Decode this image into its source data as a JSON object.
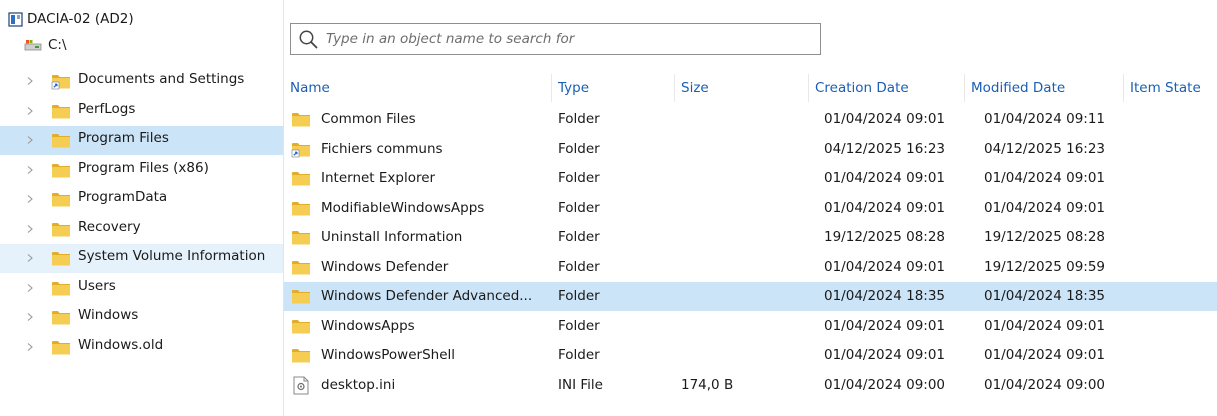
{
  "tree": {
    "root_label": "DACIA-02 (AD2)",
    "drive_label": "C:\\",
    "items": [
      {
        "label": "Documents and Settings",
        "shortcut": true,
        "state": ""
      },
      {
        "label": "PerfLogs",
        "shortcut": false,
        "state": ""
      },
      {
        "label": "Program Files",
        "shortcut": false,
        "state": "selected"
      },
      {
        "label": "Program Files (x86)",
        "shortcut": false,
        "state": ""
      },
      {
        "label": "ProgramData",
        "shortcut": false,
        "state": ""
      },
      {
        "label": "Recovery",
        "shortcut": false,
        "state": ""
      },
      {
        "label": "System Volume Information",
        "shortcut": false,
        "state": "hover"
      },
      {
        "label": "Users",
        "shortcut": false,
        "state": ""
      },
      {
        "label": "Windows",
        "shortcut": false,
        "state": ""
      },
      {
        "label": "Windows.old",
        "shortcut": false,
        "state": ""
      }
    ]
  },
  "search": {
    "placeholder": "Type in an object name to search for",
    "value": ""
  },
  "columns": [
    {
      "key": "name",
      "label": "Name"
    },
    {
      "key": "type",
      "label": "Type"
    },
    {
      "key": "size",
      "label": "Size"
    },
    {
      "key": "created",
      "label": "Creation Date"
    },
    {
      "key": "modified",
      "label": "Modified Date"
    },
    {
      "key": "state",
      "label": "Item State"
    }
  ],
  "rows": [
    {
      "name": "Common Files",
      "icon": "folder",
      "type": "Folder",
      "size": "",
      "created": "01/04/2024 09:01",
      "modified": "01/04/2024 09:11",
      "state": "",
      "selected": false
    },
    {
      "name": "Fichiers communs",
      "icon": "folder-shortcut",
      "type": "Folder",
      "size": "",
      "created": "04/12/2025 16:23",
      "modified": "04/12/2025 16:23",
      "state": "",
      "selected": false
    },
    {
      "name": "Internet Explorer",
      "icon": "folder",
      "type": "Folder",
      "size": "",
      "created": "01/04/2024 09:01",
      "modified": "01/04/2024 09:01",
      "state": "",
      "selected": false
    },
    {
      "name": "ModifiableWindowsApps",
      "icon": "folder",
      "type": "Folder",
      "size": "",
      "created": "01/04/2024 09:01",
      "modified": "01/04/2024 09:01",
      "state": "",
      "selected": false
    },
    {
      "name": "Uninstall Information",
      "icon": "folder",
      "type": "Folder",
      "size": "",
      "created": "19/12/2025 08:28",
      "modified": "19/12/2025 08:28",
      "state": "",
      "selected": false
    },
    {
      "name": "Windows Defender",
      "icon": "folder",
      "type": "Folder",
      "size": "",
      "created": "01/04/2024 09:01",
      "modified": "19/12/2025 09:59",
      "state": "",
      "selected": false
    },
    {
      "name": "Windows Defender Advanced...",
      "icon": "folder",
      "type": "Folder",
      "size": "",
      "created": "01/04/2024 18:35",
      "modified": "01/04/2024 18:35",
      "state": "",
      "selected": true
    },
    {
      "name": "WindowsApps",
      "icon": "folder",
      "type": "Folder",
      "size": "",
      "created": "01/04/2024 09:01",
      "modified": "01/04/2024 09:01",
      "state": "",
      "selected": false
    },
    {
      "name": "WindowsPowerShell",
      "icon": "folder",
      "type": "Folder",
      "size": "",
      "created": "01/04/2024 09:01",
      "modified": "01/04/2024 09:01",
      "state": "",
      "selected": false
    },
    {
      "name": "desktop.ini",
      "icon": "settings-file",
      "type": "INI File",
      "size": "174,0 B",
      "created": "01/04/2024 09:00",
      "modified": "01/04/2024 09:00",
      "state": "",
      "selected": false
    }
  ],
  "colors": {
    "accent": "#1a5fb4",
    "selection": "#cce4f7",
    "hover": "#e5f1fb",
    "folder": "#f3c94c"
  }
}
